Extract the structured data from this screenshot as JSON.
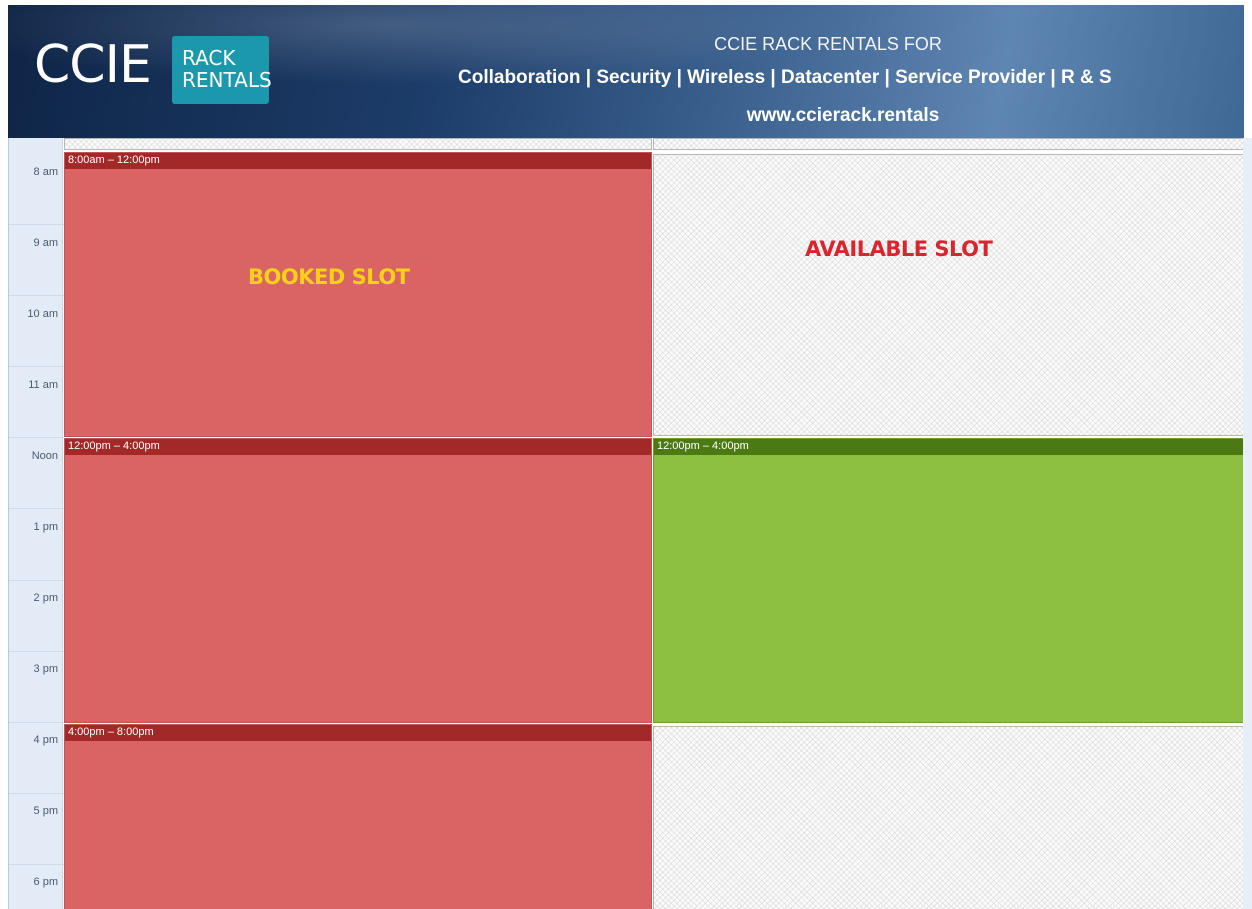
{
  "banner": {
    "logo_main": "CCIE",
    "logo_sub_1": "RACK",
    "logo_sub_2": "RENTALS",
    "line1": "CCIE RACK RENTALS FOR",
    "line2": "Collaboration | Security | Wireless | Datacenter | Service Provider | R & S",
    "line3": "www.ccierack.rentals"
  },
  "times": [
    "8 am",
    "9 am",
    "10 am",
    "11 am",
    "Noon",
    "1 pm",
    "2 pm",
    "3 pm",
    "4 pm",
    "5 pm",
    "6 pm"
  ],
  "left_column": {
    "events": [
      {
        "time": "8:00am – 12:00pm",
        "status": "booked"
      },
      {
        "time": "12:00pm – 4:00pm",
        "status": "booked"
      },
      {
        "time": "4:00pm – 8:00pm",
        "status": "booked"
      }
    ],
    "label": "BOOKED SLOT"
  },
  "right_column": {
    "event": {
      "time": "12:00pm – 4:00pm",
      "status": "available"
    },
    "label": "AVAILABLE SLOT"
  },
  "colors": {
    "booked": "#da6464",
    "booked_header": "#a32929",
    "available": "#8dbf41",
    "available_header": "#4b7a14",
    "booked_label": "#f7d117",
    "available_label": "#d9262e"
  }
}
